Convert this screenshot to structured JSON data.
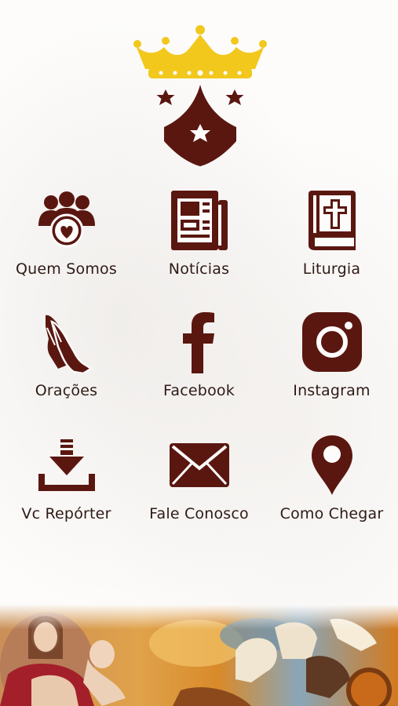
{
  "brand": {
    "accent": "#5a1710",
    "gold": "#f2c81d",
    "label_color": "#2e1a16"
  },
  "menu": [
    {
      "label": "Quem Somos",
      "icon": "community-heart-icon"
    },
    {
      "label": "Notícias",
      "icon": "newspaper-icon"
    },
    {
      "label": "Liturgia",
      "icon": "bible-icon"
    },
    {
      "label": "Orações",
      "icon": "praying-hands-icon"
    },
    {
      "label": "Facebook",
      "icon": "facebook-icon"
    },
    {
      "label": "Instagram",
      "icon": "instagram-icon"
    },
    {
      "label": "Vc Repórter",
      "icon": "download-icon"
    },
    {
      "label": "Fale Conosco",
      "icon": "envelope-icon"
    },
    {
      "label": "Como Chegar",
      "icon": "location-pin-icon"
    }
  ]
}
